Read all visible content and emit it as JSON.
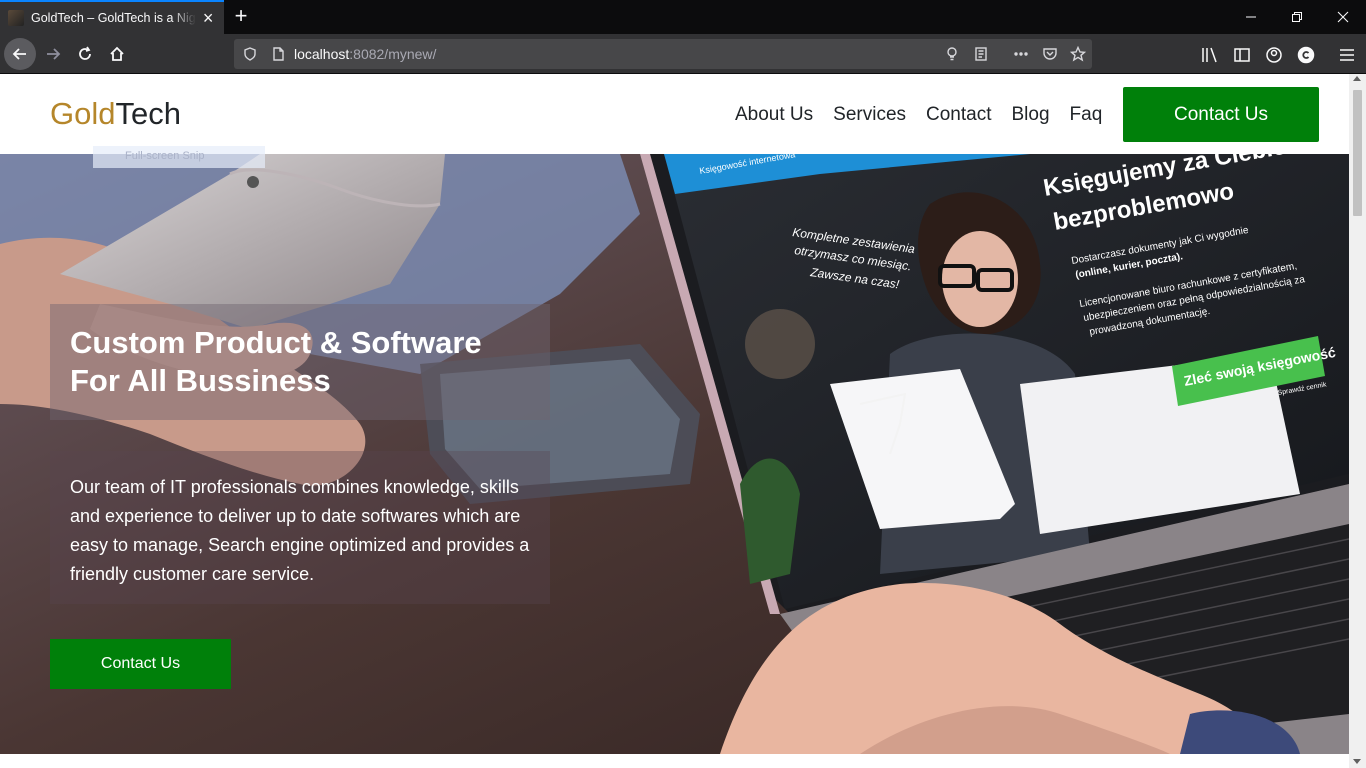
{
  "browser": {
    "tab_title": "GoldTech – GoldTech is a Nigerian IT company",
    "url_host": "localhost",
    "url_rest": ":8082/mynew/",
    "icons": [
      "back-icon",
      "forward-icon",
      "reload-icon",
      "home-icon",
      "shield-icon",
      "page-icon",
      "lightbulb-icon",
      "reader-icon",
      "more-icon",
      "pocket-icon",
      "star-icon",
      "library-icon",
      "sidebar-icon",
      "account-icon",
      "extension-icon",
      "menu-icon"
    ]
  },
  "site": {
    "logo_gold": "Gold",
    "logo_tech": "Tech",
    "nav": [
      "About Us",
      "Services",
      "Contact",
      "Blog",
      "Faq"
    ],
    "header_cta": "Contact Us",
    "snip_overlay": "Full-screen Snip"
  },
  "hero": {
    "title_line1": "Custom Product & Software",
    "title_line2": "For All Bussiness",
    "description": "Our team of IT professionals combines knowledge, skills and experience to deliver up to date softwares which are easy to manage, Search engine optimized and provides a friendly customer care service.",
    "cta": "Contact Us",
    "screen_tab": "Księgowość internetowa",
    "screen_headline_1": "Księgujemy za Ciebie",
    "screen_headline_2": "bezproblemowo",
    "screen_bullet_1a": "Dostarczasz dokumenty jak Ci wygodnie",
    "screen_bullet_1b": "(online, kurier, poczta).",
    "screen_bullet_2a": "Licencjonowane biuro rachunkowe z certyfikatem,",
    "screen_bullet_2b": "ubezpieczeniem oraz pełną odpowiedzialnością za",
    "screen_bullet_2c": "prowadzoną dokumentację.",
    "screen_button": "Zleć swoją księgowość",
    "screen_small": "Sprawdź cennik",
    "screen_hand_1": "Kompletne zestawienia",
    "screen_hand_2": "otrzymasz co miesiąc.",
    "screen_hand_3": "Zawsze na czas!"
  },
  "colors": {
    "accent_green": "#00800a",
    "logo_gold": "#b5862a"
  }
}
